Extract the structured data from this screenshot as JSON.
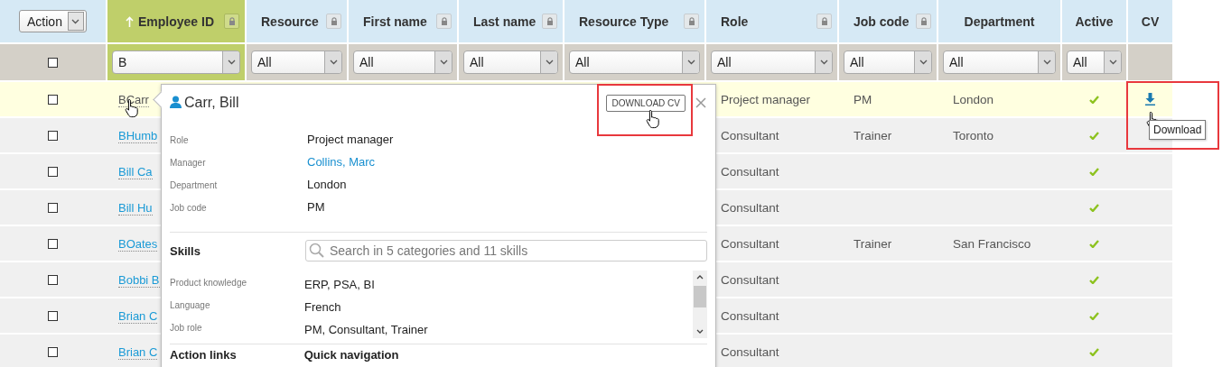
{
  "action_menu": {
    "label": "Action"
  },
  "columns": [
    {
      "label": "Employee ID",
      "sorted": true,
      "locked": true,
      "filter": "B"
    },
    {
      "label": "Resource",
      "sorted": false,
      "locked": true,
      "filter": "All"
    },
    {
      "label": "First name",
      "sorted": false,
      "locked": true,
      "filter": "All"
    },
    {
      "label": "Last name",
      "sorted": false,
      "locked": true,
      "filter": "All"
    },
    {
      "label": "Resource Type",
      "sorted": false,
      "locked": true,
      "filter": "All"
    },
    {
      "label": "Role",
      "sorted": false,
      "locked": true,
      "filter": "All"
    },
    {
      "label": "Job code",
      "sorted": false,
      "locked": true,
      "filter": "All"
    },
    {
      "label": "Department",
      "sorted": false,
      "locked": false,
      "filter": "All"
    },
    {
      "label": "Active",
      "sorted": false,
      "locked": false,
      "filter": "All"
    },
    {
      "label": "CV",
      "sorted": false,
      "locked": false
    }
  ],
  "select_all": {
    "checked": false
  },
  "rows": [
    {
      "selected": true,
      "checked": false,
      "employee_id": "BCarr",
      "role": "Project manager",
      "job_code": "PM",
      "department": "London",
      "active": true,
      "cv_download": true
    },
    {
      "selected": false,
      "checked": false,
      "employee_id": "BHumb",
      "role": "Consultant",
      "job_code": "Trainer",
      "department": "Toronto",
      "active": true,
      "cv_download": false
    },
    {
      "selected": false,
      "checked": false,
      "employee_id": "Bill Ca",
      "role": "Consultant",
      "active": true,
      "cv_download": false
    },
    {
      "selected": false,
      "checked": false,
      "employee_id": "Bill Hu",
      "role": "Consultant",
      "active": true,
      "cv_download": false
    },
    {
      "selected": false,
      "checked": false,
      "employee_id": "BOates",
      "role": "Consultant",
      "job_code": "Trainer",
      "department": "San Francisco",
      "active": true,
      "cv_download": false
    },
    {
      "selected": false,
      "checked": false,
      "employee_id": "Bobbi B",
      "role": "Consultant",
      "active": true,
      "cv_download": false
    },
    {
      "selected": false,
      "checked": false,
      "employee_id": "Brian C",
      "role": "Consultant",
      "active": true,
      "cv_download": false
    },
    {
      "selected": false,
      "checked": false,
      "employee_id": "Brian C",
      "role": "Consultant",
      "active": true,
      "cv_download": false
    }
  ],
  "tooltip": "Download",
  "popup": {
    "title": "Carr, Bill",
    "download_button": "DOWNLOAD CV",
    "details": [
      {
        "label": "Role",
        "value": "Project manager",
        "kind": "text"
      },
      {
        "label": "Manager",
        "value": "Collins, Marc",
        "kind": "link"
      },
      {
        "label": "Department",
        "value": "London",
        "kind": "text"
      },
      {
        "label": "Job code",
        "value": "PM",
        "kind": "text"
      }
    ],
    "skills": {
      "heading": "Skills",
      "search_placeholder": "Search in 5 categories and 11 skills",
      "items": [
        {
          "label": "Product knowledge",
          "value": "ERP, PSA, BI"
        },
        {
          "label": "Language",
          "value": "French"
        },
        {
          "label": "Job role",
          "value": "PM, Consultant, Trainer"
        }
      ]
    },
    "sections": [
      "Action links",
      "Quick navigation"
    ]
  }
}
